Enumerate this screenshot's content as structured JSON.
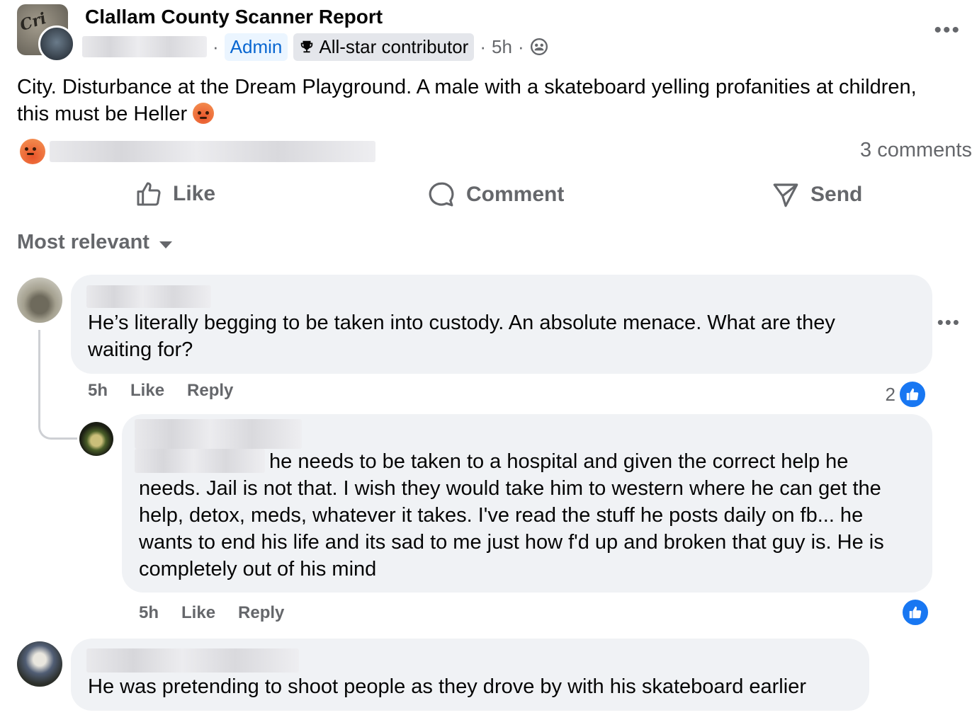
{
  "post": {
    "group_name": "Clallam County Scanner Report",
    "badge_admin": "Admin",
    "badge_contributor": "All-star contributor",
    "time": "5h",
    "text": "City.  Disturbance at the Dream Playground.  A male with a skateboard yelling profanities at children, this must be Heller",
    "comments_count": "3 comments",
    "privacy_icon": "group-icon",
    "reaction_icon": "angry-emoji"
  },
  "actions": {
    "like": "Like",
    "comment": "Comment",
    "send": "Send"
  },
  "sort": {
    "label": "Most relevant"
  },
  "comments": [
    {
      "text": "He’s literally begging to be taken into custody. An absolute menace. What are they waiting for?",
      "time": "5h",
      "like": "Like",
      "reply": "Reply",
      "likes": "2"
    },
    {
      "text": "he needs to be taken to a hospital and given the correct help he needs. Jail is not that. I wish they would take him to western where he can get the help, detox, meds, whatever it takes. I've read the stuff he posts daily on fb... he wants to end his life and its sad to me just how f'd up and broken that guy is. He is completely out of his mind",
      "time": "5h",
      "like": "Like",
      "reply": "Reply"
    },
    {
      "text": "He was pretending to shoot people as they drove by with his skateboard earlier"
    }
  ],
  "colors": {
    "accent": "#1877f2",
    "secondary_text": "#65676b",
    "bubble": "#f0f2f5"
  }
}
